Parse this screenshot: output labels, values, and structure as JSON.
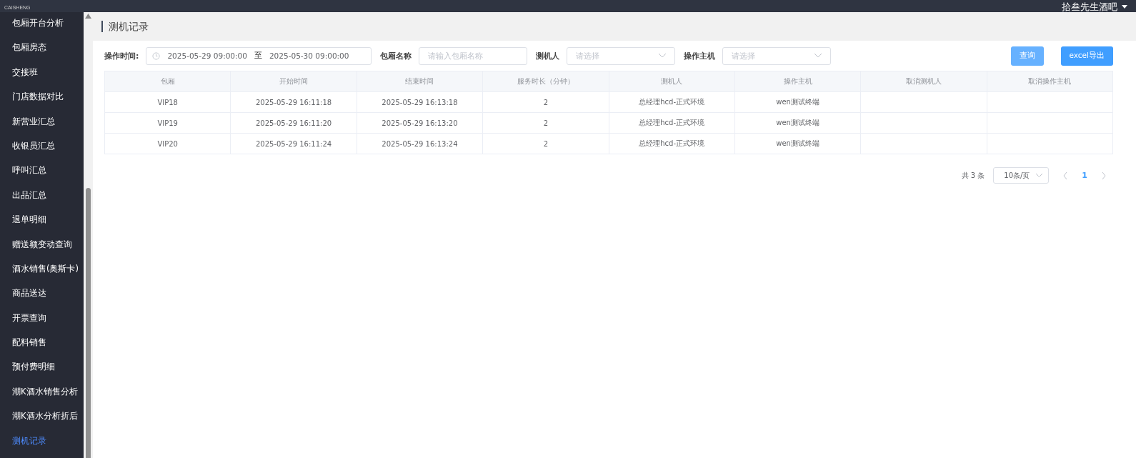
{
  "top_bar": {
    "logo_text": "CAISHENG",
    "user_menu": "拾叁先生酒吧"
  },
  "sidebar": {
    "items": [
      {
        "label": "包厢开台分析",
        "selected": false
      },
      {
        "label": "包厢房态",
        "selected": false
      },
      {
        "label": "交接班",
        "selected": false
      },
      {
        "label": "门店数据对比",
        "selected": false
      },
      {
        "label": "新营业汇总",
        "selected": false
      },
      {
        "label": "收银员汇总",
        "selected": false
      },
      {
        "label": "呼叫汇总",
        "selected": false
      },
      {
        "label": "出品汇总",
        "selected": false
      },
      {
        "label": "退单明细",
        "selected": false
      },
      {
        "label": "赠送额变动查询",
        "selected": false
      },
      {
        "label": "酒水销售(奥斯卡)",
        "selected": false
      },
      {
        "label": "商品送达",
        "selected": false
      },
      {
        "label": "开票查询",
        "selected": false
      },
      {
        "label": "配料销售",
        "selected": false
      },
      {
        "label": "预付费明细",
        "selected": false
      },
      {
        "label": "潮K酒水销售分析",
        "selected": false
      },
      {
        "label": "潮K酒水分析折后",
        "selected": false
      },
      {
        "label": "测机记录",
        "selected": true
      }
    ]
  },
  "page_title": "测机记录",
  "filters": {
    "time_label": "操作时间:",
    "time_start": "2025-05-29 09:00:00",
    "time_separator": "至",
    "time_end": "2025-05-30 09:00:00",
    "room_label": "包厢名称",
    "room_placeholder": "请输入包厢名称",
    "tester_label": "测机人",
    "tester_placeholder": "请选择",
    "host_label": "操作主机",
    "host_placeholder": "请选择",
    "buttons": [
      "查询",
      "excel导出"
    ]
  },
  "table": {
    "columns": [
      "包厢",
      "开始时间",
      "结束时间",
      "服务时长（分钟）",
      "测机人",
      "操作主机",
      "取消测机人",
      "取消操作主机"
    ],
    "rows": [
      [
        "VIP18",
        "2025-05-29 16:11:18",
        "2025-05-29 16:13:18",
        "2",
        "总经理hcd-正式环境",
        "wen测试终端",
        "",
        ""
      ],
      [
        "VIP19",
        "2025-05-29 16:11:20",
        "2025-05-29 16:13:20",
        "2",
        "总经理hcd-正式环境",
        "wen测试终端",
        "",
        ""
      ],
      [
        "VIP20",
        "2025-05-29 16:11:24",
        "2025-05-29 16:13:24",
        "2",
        "总经理hcd-正式环境",
        "wen测试终端",
        "",
        ""
      ]
    ]
  },
  "pagination": {
    "total": "共 3 条",
    "page_size": "10条/页",
    "pages": [
      {
        "label": "1",
        "selected": true
      }
    ]
  }
}
